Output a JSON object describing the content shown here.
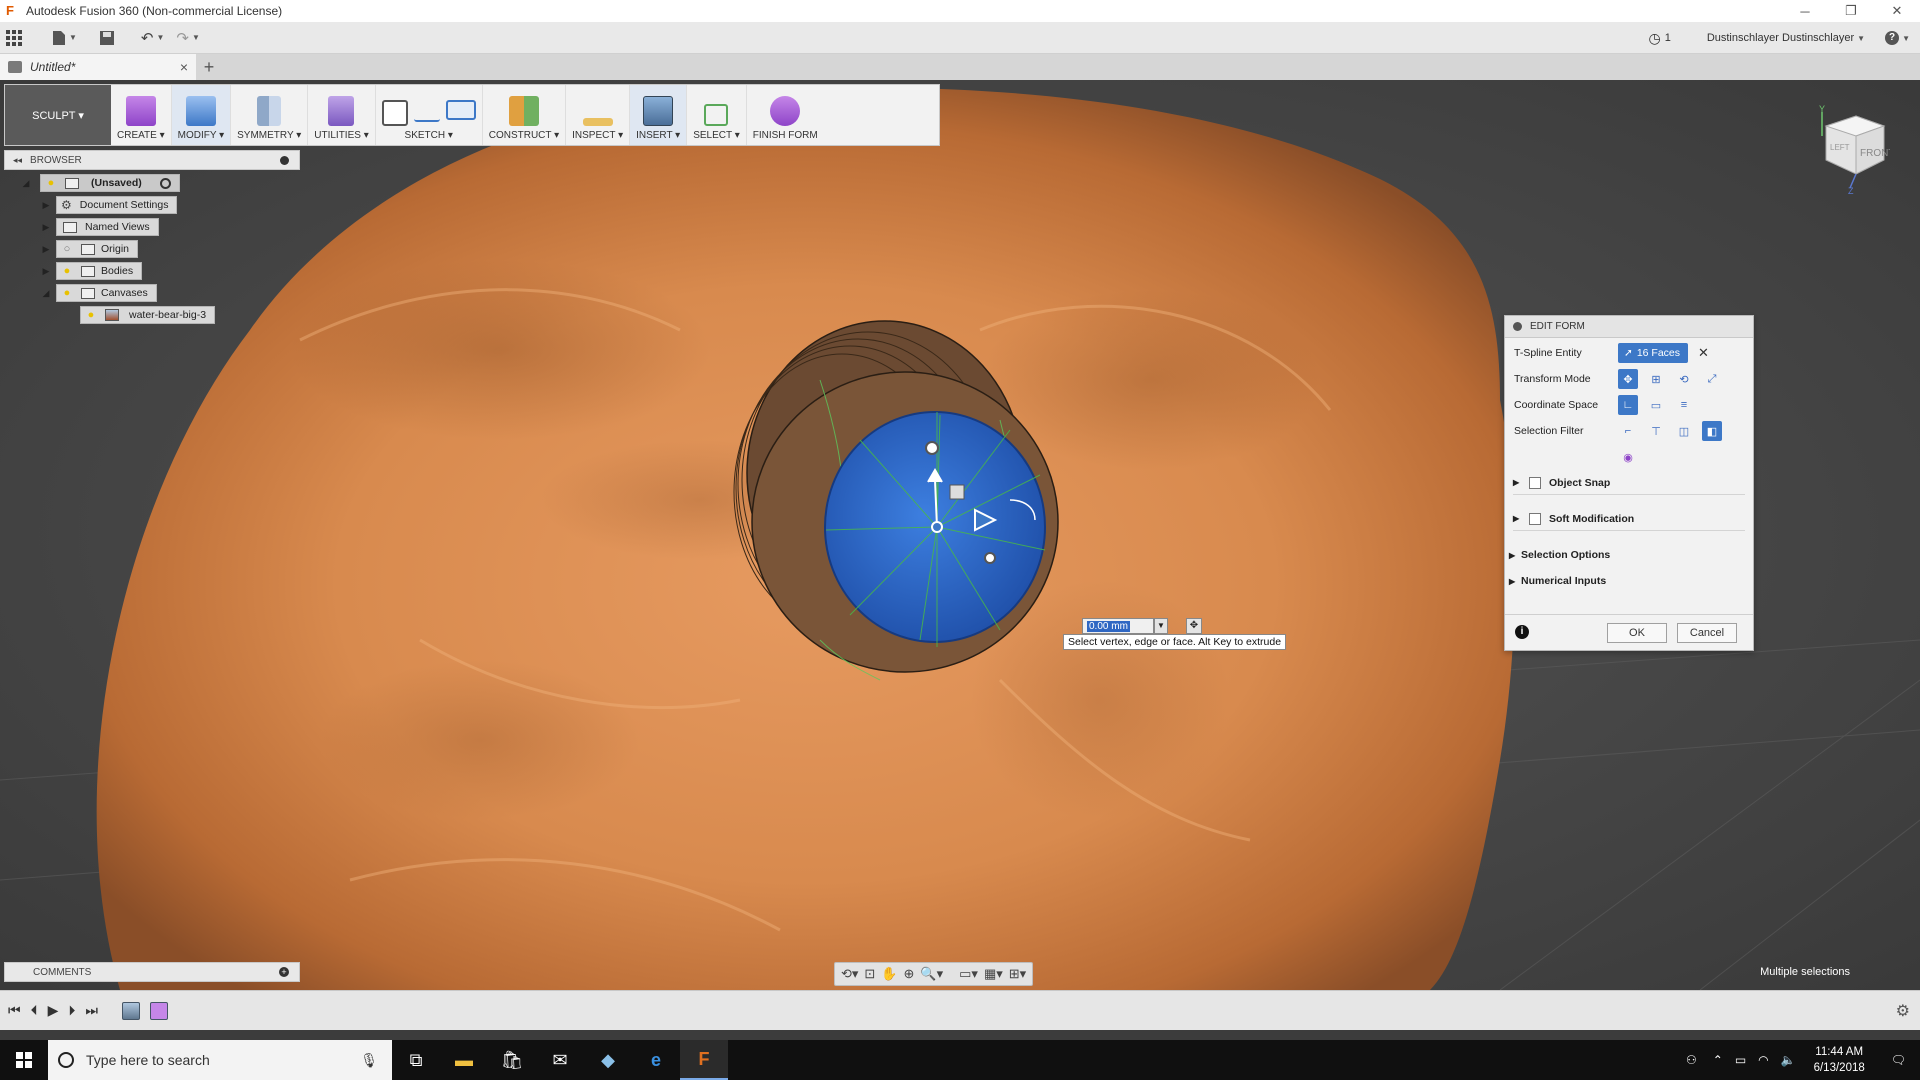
{
  "window": {
    "title": "Autodesk Fusion 360 (Non-commercial License)",
    "controls": {
      "minimize": "─",
      "restore": "❐",
      "close": "✕"
    }
  },
  "qat": {
    "jobs_count": "1",
    "user": "Dustinschlayer Dustinschlayer",
    "help": "?"
  },
  "doc_tab": {
    "label": "Untitled*",
    "close": "×",
    "new": "+"
  },
  "ribbon": {
    "workspace": "SCULPT ▾",
    "tools": [
      {
        "label": "CREATE ▾"
      },
      {
        "label": "MODIFY ▾"
      },
      {
        "label": "SYMMETRY ▾"
      },
      {
        "label": "UTILITIES ▾"
      },
      {
        "label": "SKETCH ▾"
      },
      {
        "label": "CONSTRUCT ▾"
      },
      {
        "label": "INSPECT ▾"
      },
      {
        "label": "INSERT ▾"
      },
      {
        "label": "SELECT ▾"
      },
      {
        "label": "FINISH FORM"
      }
    ]
  },
  "browser": {
    "title": "BROWSER",
    "items": [
      {
        "label": "(Unsaved)"
      },
      {
        "label": "Document Settings"
      },
      {
        "label": "Named Views"
      },
      {
        "label": "Origin"
      },
      {
        "label": "Bodies"
      },
      {
        "label": "Canvases"
      },
      {
        "label": "water-bear-big-3"
      }
    ]
  },
  "comments": {
    "title": "COMMENTS"
  },
  "edit_form": {
    "title": "EDIT FORM",
    "tspline_label": "T-Spline Entity",
    "tspline_value": "16 Faces",
    "transform_label": "Transform Mode",
    "coord_label": "Coordinate Space",
    "filter_label": "Selection Filter",
    "object_snap": "Object Snap",
    "soft_mod": "Soft Modification",
    "sel_options": "Selection Options",
    "num_inputs": "Numerical Inputs",
    "ok": "OK",
    "cancel": "Cancel"
  },
  "manipulator": {
    "value": "0.00 mm",
    "tooltip": "Select vertex, edge or face. Alt Key to extrude"
  },
  "viewcube": {
    "face": "FRONT",
    "left_face": "LEFT",
    "axis_y": "Y",
    "axis_z": "Z"
  },
  "status": {
    "right_text": "Multiple selections"
  },
  "taskbar": {
    "search_placeholder": "Type here to search",
    "time": "11:44 AM",
    "date": "6/13/2018"
  },
  "colors": {
    "canvas_orange": "#d98c52",
    "tspline_blue": "#2f6fd0",
    "accent_blue": "#3d78c7"
  }
}
